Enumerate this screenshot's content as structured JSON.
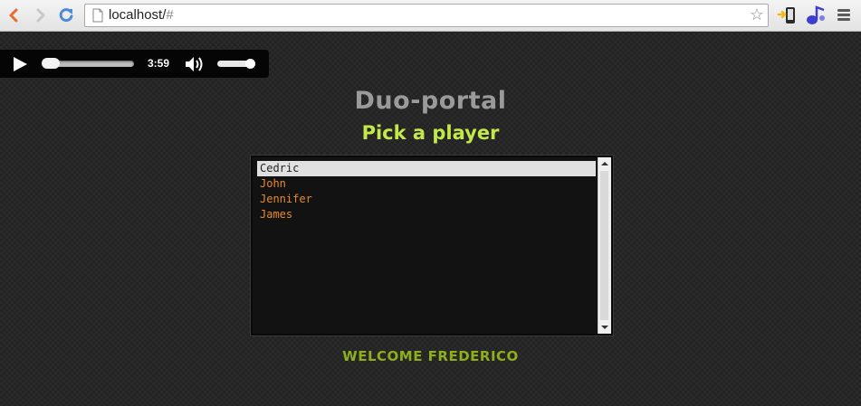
{
  "browser": {
    "url_host": "localhost/",
    "url_hash": "#"
  },
  "audio": {
    "time": "3:59",
    "progress": 0.03,
    "volume": 0.9
  },
  "page": {
    "title": "Duo-portal",
    "subtitle": "Pick a player",
    "players": [
      "Cedric",
      "John",
      "Jennifer",
      "James"
    ],
    "selected_player": "Cedric",
    "welcome": "WELCOME FREDERICO"
  },
  "colors": {
    "title": "#9a9a9a",
    "subtitle": "#c2e84a",
    "list_item": "#e58a2c",
    "welcome": "#8fae1b"
  }
}
